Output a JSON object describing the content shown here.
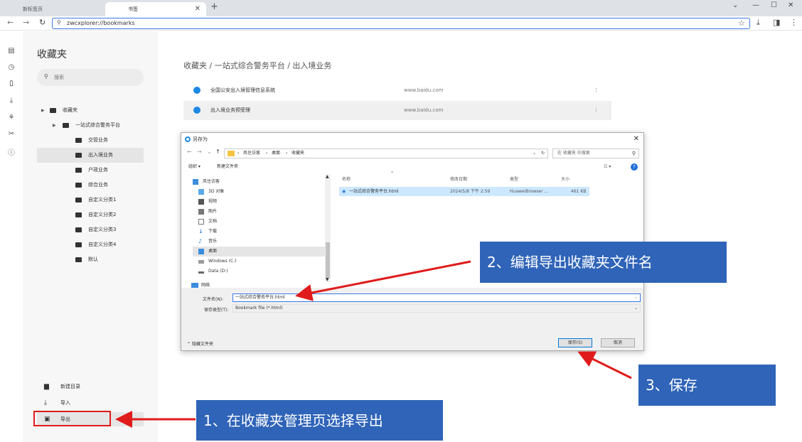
{
  "tabs": [
    {
      "label": "新标签页",
      "active": false
    },
    {
      "label": "书签",
      "active": true
    }
  ],
  "new_tab_symbol": "+",
  "toolbar": {
    "url": "zwcxplorer://bookmarks"
  },
  "sidebar": {
    "title": "收藏夹",
    "search_placeholder": "搜索",
    "tree": [
      {
        "label": "收藏夹",
        "level": 0,
        "expandable": true,
        "selected": false
      },
      {
        "label": "一站式综合警务平台",
        "level": 1,
        "expandable": true,
        "selected": false
      },
      {
        "label": "交管业务",
        "level": 2,
        "expandable": false,
        "selected": false
      },
      {
        "label": "出入境业务",
        "level": 2,
        "expandable": false,
        "selected": true
      },
      {
        "label": "户政业务",
        "level": 2,
        "expandable": false,
        "selected": false
      },
      {
        "label": "综合业务",
        "level": 2,
        "expandable": false,
        "selected": false
      },
      {
        "label": "自定义分类1",
        "level": 2,
        "expandable": false,
        "selected": false
      },
      {
        "label": "自定义分类2",
        "level": 2,
        "expandable": false,
        "selected": false
      },
      {
        "label": "自定义分类3",
        "level": 2,
        "expandable": false,
        "selected": false
      },
      {
        "label": "自定义分类4",
        "level": 2,
        "expandable": false,
        "selected": false
      },
      {
        "label": "默认",
        "level": 2,
        "expandable": false,
        "selected": false
      }
    ],
    "bottom_actions": [
      {
        "label": "新建目录",
        "icon": "folder-plus-icon"
      },
      {
        "label": "导入",
        "icon": "import-icon"
      },
      {
        "label": "导出",
        "icon": "save-icon"
      }
    ]
  },
  "main": {
    "breadcrumb": "收藏夹 / 一站式综合警务平台 / 出入境业务",
    "bookmarks": [
      {
        "name": "全国公安出入境管理信息系统",
        "url": "www.baidu.com",
        "highlighted": false
      },
      {
        "name": "出入境业务预受理",
        "url": "www.baidu.com",
        "highlighted": true
      }
    ]
  },
  "dialog": {
    "title": "另存为",
    "path_items": [
      "风住访客",
      "桌面",
      "收藏夹"
    ],
    "search_placeholder": "在 收藏夹 中搜索",
    "organize": "组织 ▾",
    "new_folder": "新建文件夹",
    "nav_items": [
      {
        "label": "风住访客",
        "icon": "computer-icon"
      },
      {
        "label": "3D 对象",
        "icon": "cube-icon"
      },
      {
        "label": "视频",
        "icon": "video-icon"
      },
      {
        "label": "图片",
        "icon": "picture-icon"
      },
      {
        "label": "文档",
        "icon": "document-icon"
      },
      {
        "label": "下载",
        "icon": "download-icon"
      },
      {
        "label": "音乐",
        "icon": "music-icon"
      },
      {
        "label": "桌面",
        "icon": "desktop-icon",
        "selected": true
      },
      {
        "label": "Windows (C:)",
        "icon": "drive-icon"
      },
      {
        "label": "Data (D:)",
        "icon": "drive-icon"
      },
      {
        "label": "网络",
        "icon": "network-icon"
      }
    ],
    "columns": {
      "name": "名称",
      "date": "修改日期",
      "type": "类型",
      "size": "大小"
    },
    "file": {
      "name": "一站式综合警务平台.html",
      "date": "2024/5/8 下午 2:59",
      "type": "HuaweiBrowser ...",
      "size": "461 KB"
    },
    "filename_label": "文件名(N):",
    "filename_value": "一站式综合警务平台.html",
    "filetype_label": "保存类型(T):",
    "filetype_value": "Bookmark file (*.html)",
    "hide_folders": "隐藏文件夹",
    "save_label": "保存(S)",
    "cancel_label": "取消"
  },
  "annotations": {
    "step1": "1、在收藏夹管理页选择导出",
    "step2": "2、编辑导出收藏夹文件名",
    "step3": "3、保存",
    "callout_color": "#2f64b8",
    "arrow_color": "#e01b1b"
  }
}
